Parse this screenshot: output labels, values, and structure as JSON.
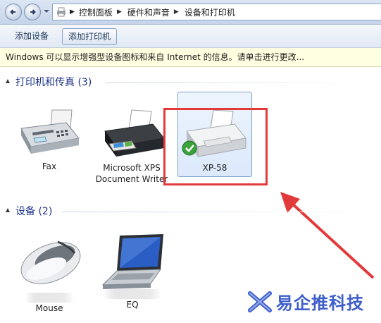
{
  "address": {
    "breadcrumbs": [
      "控制面板",
      "硬件和声音",
      "设备和打印机"
    ]
  },
  "toolbar": {
    "add_device_label": "添加设备",
    "add_printer_label": "添加打印机"
  },
  "infobar": {
    "message": "Windows 可以显示增强型设备图标和来自 Internet 的信息。请单击进行更改..."
  },
  "groups": {
    "printers": {
      "title": "打印机和传真 (3)",
      "items": [
        {
          "label": "Fax"
        },
        {
          "label": "Microsoft XPS Document Writer"
        },
        {
          "label": "XP-58"
        }
      ]
    },
    "devices": {
      "title": "设备 (2)",
      "items": [
        {
          "label": "Mouse"
        },
        {
          "label": "EQ"
        }
      ]
    }
  },
  "watermark": {
    "text": "易企推科技"
  },
  "colors": {
    "highlight_box": "#e23a3a",
    "arrow": "#e23a3a",
    "group_title": "#1e3287",
    "watermark": "#3e5ec9"
  }
}
